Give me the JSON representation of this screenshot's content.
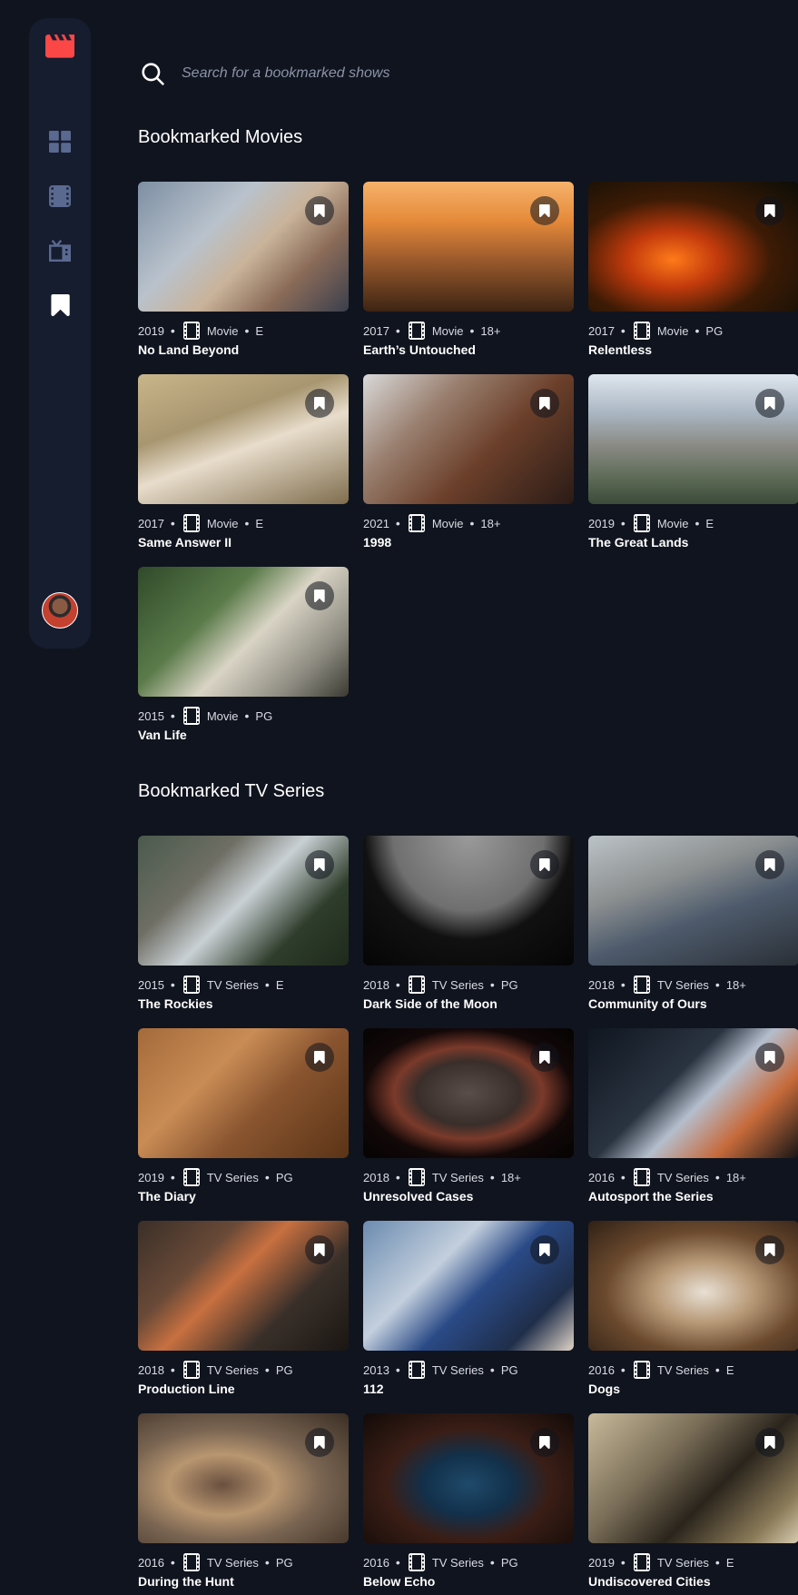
{
  "colors": {
    "background": "#10141e",
    "surface": "#161d2f",
    "accent": "#fc4747",
    "muted": "#5a698f"
  },
  "nav": {
    "items": [
      "home-icon",
      "movies-icon",
      "tv-series-icon",
      "bookmark-icon"
    ],
    "active": "bookmark-icon"
  },
  "search": {
    "placeholder": "Search for a bookmarked shows"
  },
  "movies": {
    "heading": "Bookmarked Movies",
    "items": [
      {
        "year": "2019",
        "category": "Movie",
        "rating": "E",
        "title": "No Land Beyond"
      },
      {
        "year": "2017",
        "category": "Movie",
        "rating": "18+",
        "title": "Earth’s Untouched"
      },
      {
        "year": "2017",
        "category": "Movie",
        "rating": "PG",
        "title": "Relentless"
      },
      {
        "year": "2017",
        "category": "Movie",
        "rating": "E",
        "title": "Same Answer II"
      },
      {
        "year": "2021",
        "category": "Movie",
        "rating": "18+",
        "title": "1998"
      },
      {
        "year": "2019",
        "category": "Movie",
        "rating": "E",
        "title": "The Great Lands"
      },
      {
        "year": "2015",
        "category": "Movie",
        "rating": "PG",
        "title": "Van Life"
      }
    ]
  },
  "series": {
    "heading": "Bookmarked TV Series",
    "items": [
      {
        "year": "2015",
        "category": "TV Series",
        "rating": "E",
        "title": "The Rockies"
      },
      {
        "year": "2018",
        "category": "TV Series",
        "rating": "PG",
        "title": "Dark Side of the Moon"
      },
      {
        "year": "2018",
        "category": "TV Series",
        "rating": "18+",
        "title": "Community of Ours"
      },
      {
        "year": "2019",
        "category": "TV Series",
        "rating": "PG",
        "title": "The Diary"
      },
      {
        "year": "2018",
        "category": "TV Series",
        "rating": "18+",
        "title": "Unresolved Cases"
      },
      {
        "year": "2016",
        "category": "TV Series",
        "rating": "18+",
        "title": "Autosport the Series"
      },
      {
        "year": "2018",
        "category": "TV Series",
        "rating": "PG",
        "title": "Production Line"
      },
      {
        "year": "2013",
        "category": "TV Series",
        "rating": "PG",
        "title": "112"
      },
      {
        "year": "2016",
        "category": "TV Series",
        "rating": "E",
        "title": "Dogs"
      },
      {
        "year": "2016",
        "category": "TV Series",
        "rating": "PG",
        "title": "During the Hunt"
      },
      {
        "year": "2016",
        "category": "TV Series",
        "rating": "PG",
        "title": "Below Echo"
      },
      {
        "year": "2019",
        "category": "TV Series",
        "rating": "E",
        "title": "Undiscovered Cities"
      }
    ]
  }
}
